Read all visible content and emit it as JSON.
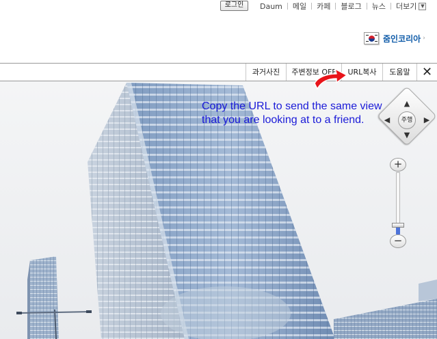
{
  "topnav": {
    "login": "로그인",
    "links": [
      "Daum",
      "메일",
      "카페",
      "블로그",
      "뉴스",
      "더보기"
    ]
  },
  "joinkorea": {
    "label": "줌인코리아",
    "arrow": "›"
  },
  "toolbar": {
    "past_photos": "과거사진",
    "around_info": "주변정보 OFF",
    "copy_url": "URL복사",
    "help": "도움말",
    "close": "✕"
  },
  "annotation": {
    "text": "Copy the URL to send the same view that you are looking at to a friend.",
    "color": "#1a1ad8"
  },
  "controls": {
    "drive": "주행",
    "up": "▲",
    "down": "▼",
    "left": "◀",
    "right": "▶",
    "zoom_in": "+",
    "zoom_out": "−",
    "zoom_level": 0.12
  },
  "colors": {
    "arrow": "#e8141a",
    "joinkorea": "#0d5aa8",
    "sky": "#f2f3f5",
    "glass": "#8ea8c8"
  }
}
